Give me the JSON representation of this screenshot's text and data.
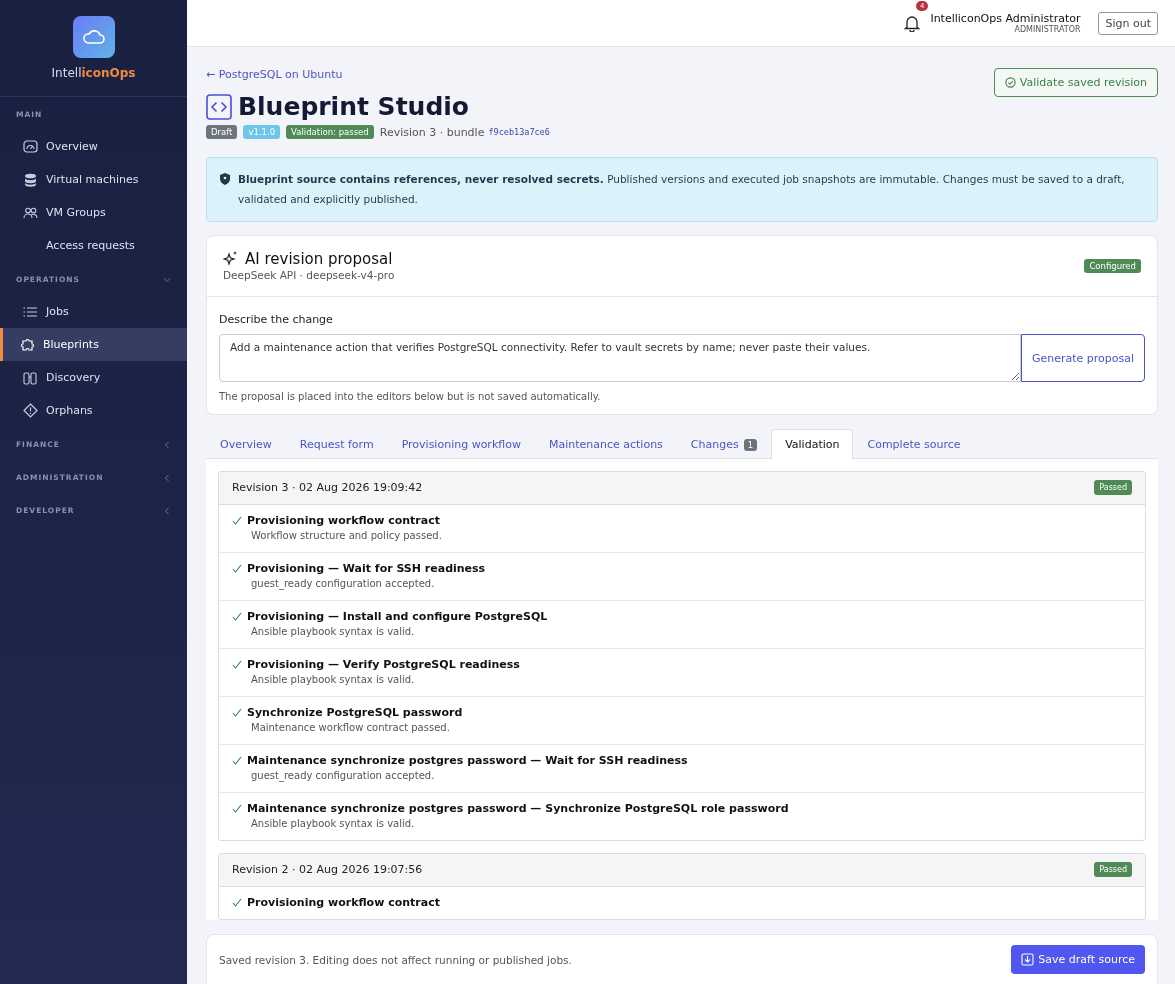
{
  "brand": {
    "prefix": "Intell",
    "accent": "iconOps"
  },
  "sidebar": {
    "sections": [
      {
        "label": "MAIN",
        "items": [
          {
            "label": "Overview",
            "selected": false
          },
          {
            "label": "Virtual machines",
            "selected": false
          },
          {
            "label": "VM Groups",
            "selected": false
          },
          {
            "label": "Access requests",
            "selected": false
          }
        ]
      },
      {
        "label": "OPERATIONS",
        "expanded": true,
        "items": [
          {
            "label": "Jobs",
            "selected": false
          },
          {
            "label": "Blueprints",
            "selected": true
          },
          {
            "label": "Discovery",
            "selected": false
          },
          {
            "label": "Orphans",
            "selected": false
          }
        ]
      },
      {
        "label": "FINANCE",
        "expanded": false
      },
      {
        "label": "ADMINISTRATION",
        "expanded": false
      },
      {
        "label": "DEVELOPER",
        "expanded": false
      }
    ]
  },
  "topbar": {
    "notifications": "4",
    "user": "IntelliconOps Administrator",
    "role": "ADMINISTRATOR",
    "signout": "Sign out"
  },
  "page": {
    "back": "← PostgreSQL on Ubuntu",
    "title": "Blueprint Studio",
    "validate_button": "Validate saved revision",
    "badges": [
      {
        "label": "Draft",
        "color": "#6c757d"
      },
      {
        "label": "v1.1.0",
        "color": "#6ec6ea"
      },
      {
        "label": "Validation: passed",
        "color": "#4f8a57"
      }
    ],
    "revision": "Revision 3 · bundle",
    "bundle": "f9ceb13a7ce6"
  },
  "alert": {
    "text": "**Blueprint source contains references, never resolved secrets.** Published versions and executed job snapshots are immutable. Changes must be saved to a draft, validated and explicitly published."
  },
  "ai": {
    "title": "AI revision proposal",
    "subtitle": "DeepSeek API · deepseek-v4-pro",
    "status": "Configured",
    "label": "Describe the change",
    "value": "Add a maintenance action that verifies PostgreSQL connectivity. Refer to vault secrets by name; never paste their values.",
    "button": "Generate proposal",
    "hint": "The proposal is placed into the editors below but is not saved automatically."
  },
  "tabs": [
    {
      "label": "Overview",
      "selected": false
    },
    {
      "label": "Request form",
      "selected": false
    },
    {
      "label": "Provisioning workflow",
      "selected": false
    },
    {
      "label": "Maintenance actions",
      "selected": false
    },
    {
      "label": "Changes",
      "count": "1",
      "selected": false
    },
    {
      "label": "Validation",
      "selected": true
    },
    {
      "label": "Complete source",
      "selected": false
    }
  ],
  "revisions": [
    {
      "title": "Revision 3 · 02 Aug 2026 19:09:42",
      "status": "Passed",
      "checks": [
        {
          "title": "Provisioning workflow contract",
          "detail": "Workflow structure and policy passed."
        },
        {
          "title": "Provisioning — Wait for SSH readiness",
          "detail": "guest_ready configuration accepted."
        },
        {
          "title": "Provisioning — Install and configure PostgreSQL",
          "detail": "Ansible playbook syntax is valid."
        },
        {
          "title": "Provisioning — Verify PostgreSQL readiness",
          "detail": "Ansible playbook syntax is valid."
        },
        {
          "title": "Synchronize PostgreSQL password",
          "detail": "Maintenance workflow contract passed."
        },
        {
          "title": "Maintenance synchronize postgres password — Wait for SSH readiness",
          "detail": "guest_ready configuration accepted."
        },
        {
          "title": "Maintenance synchronize postgres password — Synchronize PostgreSQL role password",
          "detail": "Ansible playbook syntax is valid."
        }
      ]
    },
    {
      "title": "Revision 2 · 02 Aug 2026 19:07:56",
      "status": "Passed",
      "checks": [
        {
          "title": "Provisioning workflow contract"
        }
      ]
    }
  ],
  "footer": {
    "text": "Saved revision 3. Editing does not affect running or published jobs.",
    "button": "Save draft source"
  }
}
